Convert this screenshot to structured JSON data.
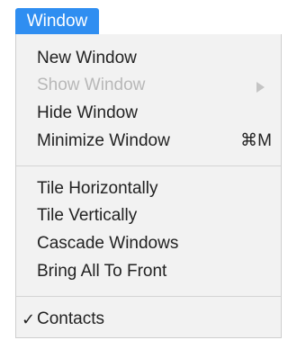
{
  "menu": {
    "title": "Window",
    "groups": [
      {
        "items": [
          {
            "label": "New Window",
            "enabled": true
          },
          {
            "label": "Show Window",
            "enabled": false,
            "submenu": true
          },
          {
            "label": "Hide Window",
            "enabled": true
          },
          {
            "label": "Minimize Window",
            "enabled": true,
            "shortcut": "⌘M"
          }
        ]
      },
      {
        "items": [
          {
            "label": "Tile Horizontally",
            "enabled": true
          },
          {
            "label": "Tile Vertically",
            "enabled": true
          },
          {
            "label": "Cascade Windows",
            "enabled": true
          },
          {
            "label": "Bring All To Front",
            "enabled": true
          }
        ]
      },
      {
        "items": [
          {
            "label": "Contacts",
            "enabled": true,
            "checked": true,
            "check_mark": "✓"
          }
        ]
      }
    ]
  },
  "colors": {
    "highlight": "#2f8ef1",
    "menu_background": "#f2f2f2",
    "text": "#222222",
    "disabled_text": "#b8b8b8"
  },
  "icons": {
    "submenu": "chevron-right-icon",
    "checked": "checkmark-icon"
  }
}
